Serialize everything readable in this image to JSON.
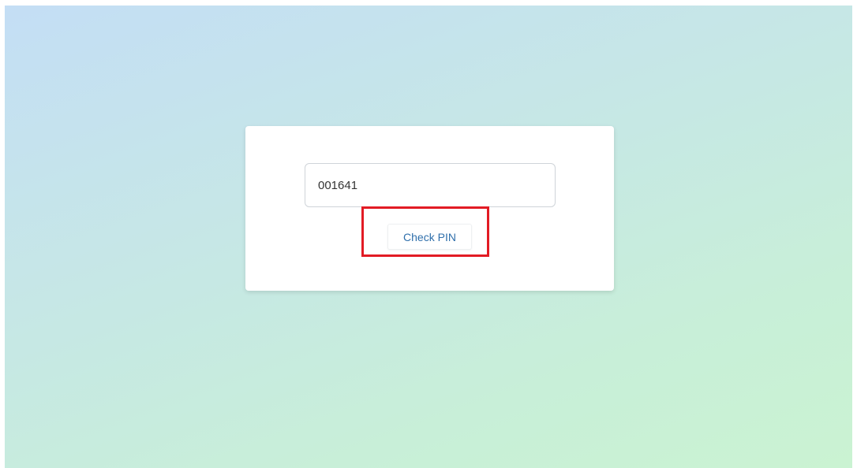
{
  "pin_form": {
    "pin_value": "001641",
    "check_button_label": "Check PIN"
  },
  "colors": {
    "background_gradient_start": "#c4def5",
    "background_gradient_end": "#caf3d2",
    "button_text": "#2f6fab",
    "highlight": "#e21b24"
  }
}
